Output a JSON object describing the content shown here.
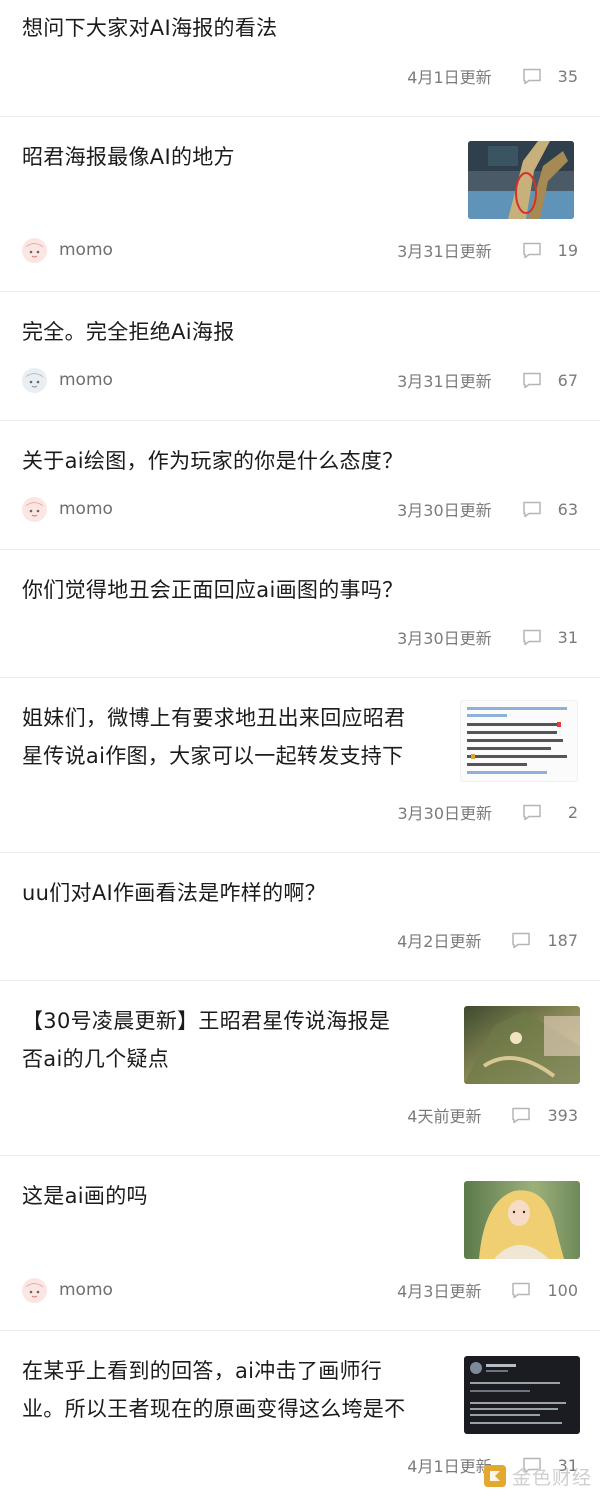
{
  "posts": [
    {
      "title": "想问下大家对AI海报的看法",
      "date": "4月1日更新",
      "comments": "35"
    },
    {
      "title": "昭君海报最像AI的地方",
      "author": "momo",
      "date": "3月31日更新",
      "comments": "19"
    },
    {
      "title": "完全。完全拒绝Ai海报",
      "author": "momo",
      "date": "3月31日更新",
      "comments": "67"
    },
    {
      "title": "关于ai绘图，作为玩家的你是什么态度？",
      "author": "momo",
      "date": "3月30日更新",
      "comments": "63"
    },
    {
      "title": "你们觉得地丑会正面回应ai画图的事吗？",
      "date": "3月30日更新",
      "comments": "31"
    },
    {
      "title_line1": "姐妹们，微博上有要求地丑出来回应昭君",
      "title_line2": "星传说ai作图，大家可以一起转发支持下",
      "date": "3月30日更新",
      "comments": "2"
    },
    {
      "title": "uu们对AI作画看法是咋样的啊？",
      "date": "4月2日更新",
      "comments": "187"
    },
    {
      "title_line1": "【30号凌晨更新】王昭君星传说海报是",
      "title_line2": "否ai的几个疑点",
      "date": "4天前更新",
      "comments": "393"
    },
    {
      "title": "这是ai画的吗",
      "author": "momo",
      "date": "4月3日更新",
      "comments": "100"
    },
    {
      "title_line1": "在某乎上看到的回答，ai冲击了画师行",
      "title_line2": "业。所以王者现在的原画变得这么垮是不",
      "date": "4月1日更新",
      "comments": "31"
    }
  ],
  "watermark": "金色财经",
  "icons": {
    "comment": "comment-icon",
    "avatar": "avatar-icon",
    "logo": "logo-icon"
  },
  "colors": {
    "text": "#1b1b1b",
    "meta": "#7b7b7b",
    "divider": "#ececec",
    "watermark": "#cfcfcf"
  }
}
